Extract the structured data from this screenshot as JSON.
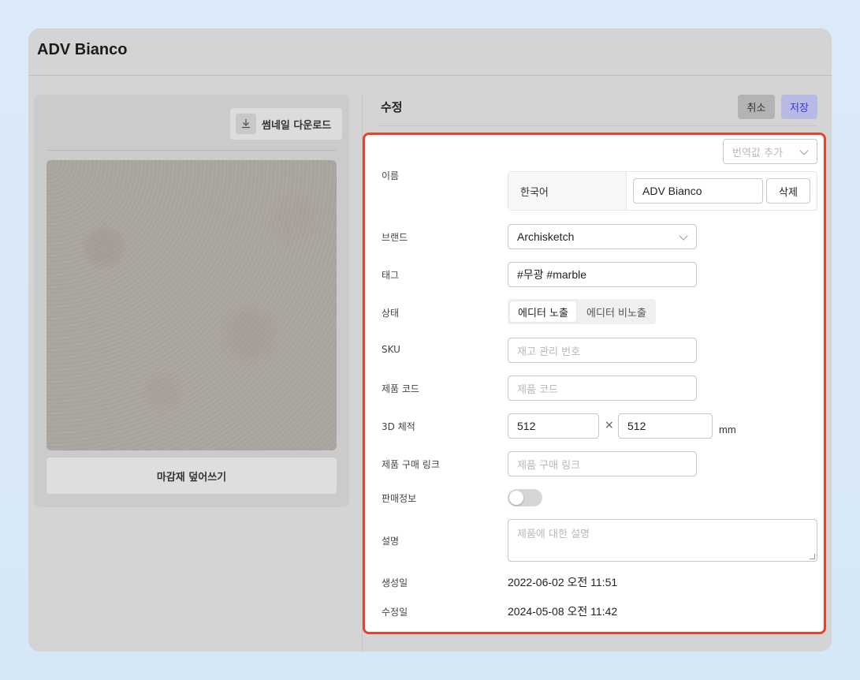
{
  "window": {
    "title": "ADV Bianco"
  },
  "left_panel": {
    "download_thumbnail_label": "썸네일 다운로드",
    "overwrite_label": "마감재 덮어쓰기"
  },
  "edit": {
    "title": "수정",
    "cancel_label": "취소",
    "save_label": "저장"
  },
  "form": {
    "translation_select_placeholder": "번역값 추가",
    "name": {
      "label": "이름",
      "language": "한국어",
      "value": "ADV Bianco",
      "delete_label": "삭제"
    },
    "brand": {
      "label": "브랜드",
      "value": "Archisketch"
    },
    "tags": {
      "label": "태그",
      "value": "#무광 #marble"
    },
    "status": {
      "label": "상태",
      "options": [
        "에디터 노출",
        "에디터 비노출"
      ],
      "selected": "에디터 노출"
    },
    "sku": {
      "label": "SKU",
      "placeholder": "재고 관리 번호"
    },
    "product_code": {
      "label": "제품 코드",
      "placeholder": "제품 코드"
    },
    "volume_3d": {
      "label": "3D 체적",
      "width": "512",
      "height": "512",
      "separator": "×",
      "unit": "mm"
    },
    "purchase_link": {
      "label": "제품 구매 링크",
      "placeholder": "제품 구매 링크"
    },
    "sales_info": {
      "label": "판매정보",
      "enabled": false
    },
    "description": {
      "label": "설명",
      "placeholder": "제품에 대한 설명"
    },
    "created": {
      "label": "생성일",
      "value": "2022-06-02 오전 11:51"
    },
    "modified": {
      "label": "수정일",
      "value": "2024-05-08 오전 11:42"
    }
  },
  "colors": {
    "highlight_border": "#e5432c",
    "save_text": "#3a3ac9"
  }
}
